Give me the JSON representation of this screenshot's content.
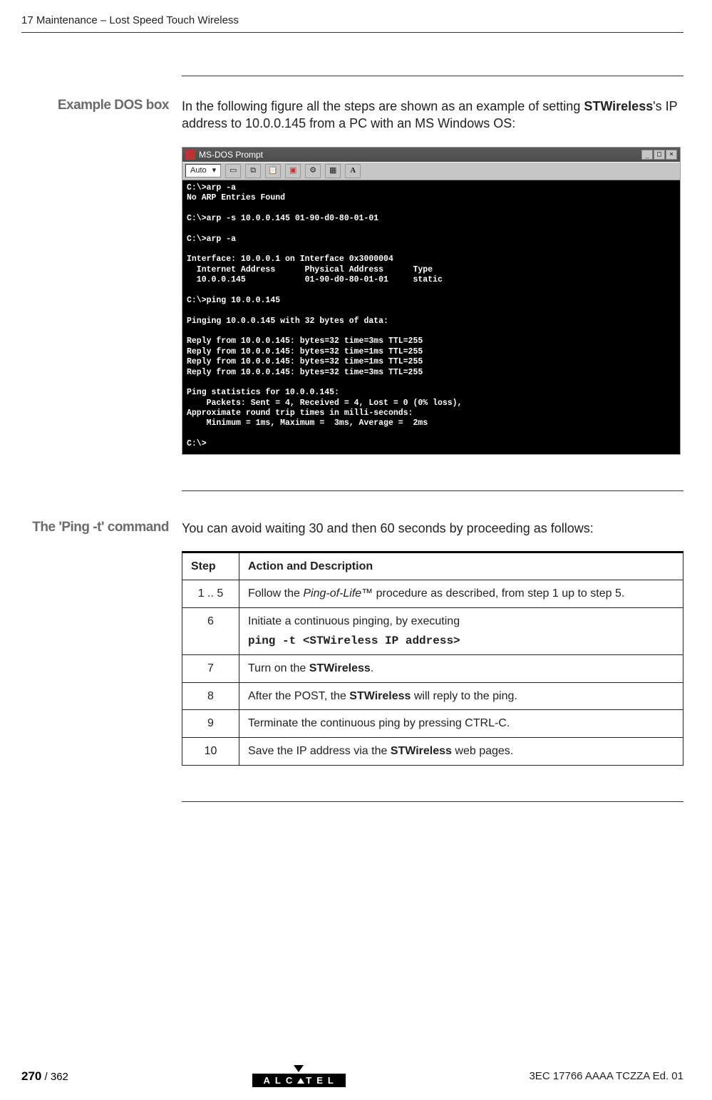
{
  "header": "17 Maintenance – Lost Speed Touch Wireless",
  "section1": {
    "title": "Example DOS box",
    "intro_1": "In the following figure all the steps are shown as an example of setting ",
    "intro_bold": "STWireless",
    "intro_2": "'s IP address to 10.0.0.145 from a PC with an MS Windows OS:"
  },
  "dos": {
    "window_title": "MS-DOS Prompt",
    "dropdown": "Auto",
    "terminal": "C:\\>arp -a\nNo ARP Entries Found\n\nC:\\>arp -s 10.0.0.145 01-90-d0-80-01-01\n\nC:\\>arp -a\n\nInterface: 10.0.0.1 on Interface 0x3000004\n  Internet Address      Physical Address      Type\n  10.0.0.145            01-90-d0-80-01-01     static\n\nC:\\>ping 10.0.0.145\n\nPinging 10.0.0.145 with 32 bytes of data:\n\nReply from 10.0.0.145: bytes=32 time=3ms TTL=255\nReply from 10.0.0.145: bytes=32 time=1ms TTL=255\nReply from 10.0.0.145: bytes=32 time=1ms TTL=255\nReply from 10.0.0.145: bytes=32 time=3ms TTL=255\n\nPing statistics for 10.0.0.145:\n    Packets: Sent = 4, Received = 4, Lost = 0 (0% loss),\nApproximate round trip times in milli-seconds:\n    Minimum = 1ms, Maximum =  3ms, Average =  2ms\n\nC:\\>"
  },
  "section2": {
    "title": "The 'Ping -t' command",
    "intro": "You can avoid waiting 30 and then 60 seconds by proceeding as follows:"
  },
  "table": {
    "header": {
      "step": "Step",
      "action": "Action and Description"
    },
    "rows": [
      {
        "step": "1 .. 5",
        "action_1": "Follow the ",
        "action_em": "Ping-of-Life™",
        "action_2": " procedure as described, from step 1 up to step 5."
      },
      {
        "step": "6",
        "action_1": "Initiate a continuous pinging, by executing",
        "cmd": "ping -t <STWireless IP address>"
      },
      {
        "step": "7",
        "action_1": "Turn on the ",
        "action_b": "STWireless",
        "action_2": "."
      },
      {
        "step": "8",
        "action_1": "After the POST, the ",
        "action_b": "STWireless",
        "action_2": " will reply to the ping."
      },
      {
        "step": "9",
        "action_1": "Terminate the continuous ping by pressing CTRL-C."
      },
      {
        "step": "10",
        "action_1": "Save the IP address via the ",
        "action_b": "STWireless",
        "action_2": " web pages."
      }
    ]
  },
  "footer": {
    "page_bold": "270",
    "page_rest": " / 362",
    "logo": "ALC   TEL",
    "doc_id": "3EC 17766 AAAA TCZZA Ed. 01"
  }
}
